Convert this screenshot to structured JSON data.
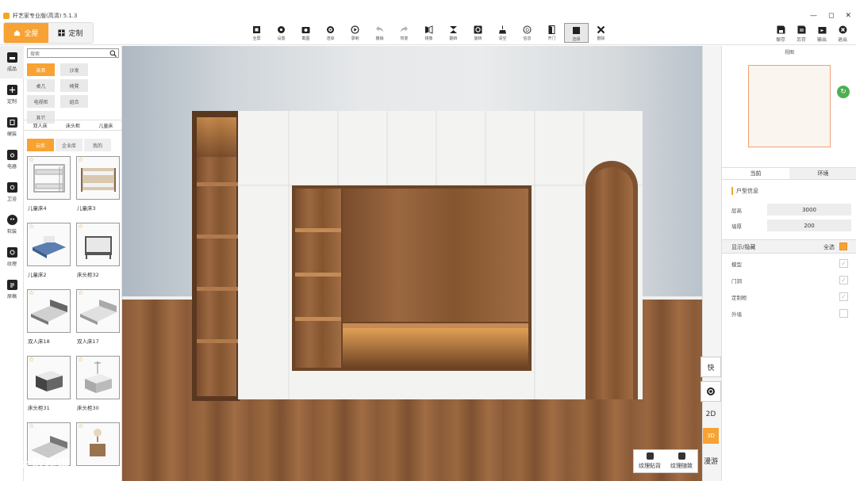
{
  "window": {
    "title": "杆艺家专业版(高清) 5.1.3",
    "controls": [
      "—",
      "◻",
      "✕"
    ]
  },
  "modes": [
    {
      "label": "全屋",
      "active": true
    },
    {
      "label": "定制",
      "active": false
    }
  ],
  "tools": [
    {
      "label": "全屏",
      "icon": "fullscreen-icon"
    },
    {
      "label": "设置",
      "icon": "settings-icon"
    },
    {
      "label": "截图",
      "icon": "camera-icon"
    },
    {
      "label": "渲染",
      "icon": "render-icon"
    },
    {
      "label": "录制",
      "icon": "record-icon"
    },
    {
      "label": "撤销",
      "icon": "undo-icon"
    },
    {
      "label": "恢复",
      "icon": "redo-icon"
    },
    {
      "label": "镜像",
      "icon": "mirror-icon"
    },
    {
      "label": "翻转",
      "icon": "flip-icon"
    },
    {
      "label": "旋转",
      "icon": "rotate-icon"
    },
    {
      "label": "清空",
      "icon": "clear-icon"
    },
    {
      "label": "信息",
      "icon": "info-icon"
    },
    {
      "label": "开门",
      "icon": "door-icon"
    },
    {
      "label": "选择",
      "icon": "select-icon"
    },
    {
      "label": "删除",
      "icon": "delete-icon"
    }
  ],
  "right_tools": [
    {
      "label": "保存",
      "icon": "save-icon"
    },
    {
      "label": "另存",
      "icon": "save-as-icon"
    },
    {
      "label": "输出",
      "icon": "export-icon"
    },
    {
      "label": "退出",
      "icon": "exit-icon"
    }
  ],
  "sidebar": [
    {
      "label": "成品",
      "icon": "sofa-icon",
      "active": true
    },
    {
      "label": "定制",
      "icon": "custom-icon"
    },
    {
      "label": "硬装",
      "icon": "hardware-icon"
    },
    {
      "label": "电器",
      "icon": "appliance-icon"
    },
    {
      "label": "卫浴",
      "icon": "bath-icon"
    },
    {
      "label": "软装",
      "icon": "decor-icon"
    },
    {
      "label": "纹理",
      "icon": "texture-icon"
    },
    {
      "label": "原稿",
      "icon": "draft-icon"
    }
  ],
  "library": {
    "search_placeholder": "搜索",
    "categories": [
      {
        "label": "床具",
        "active": true
      },
      {
        "label": "沙发"
      },
      {
        "label": "桌几"
      },
      {
        "label": "椅凳"
      },
      {
        "label": "电视柜"
      },
      {
        "label": "组合"
      },
      {
        "label": "其它"
      }
    ],
    "subcategories": [
      "双人床",
      "床头柜",
      "儿童床"
    ],
    "sources": [
      {
        "label": "云库",
        "active": true
      },
      {
        "label": "企业库"
      },
      {
        "label": "我的"
      }
    ],
    "items": [
      {
        "name": "儿童床4"
      },
      {
        "name": "儿童床3"
      },
      {
        "name": "儿童床2"
      },
      {
        "name": "床头柜32"
      },
      {
        "name": "双人床18"
      },
      {
        "name": "双人床17"
      },
      {
        "name": "床头柜31"
      },
      {
        "name": "床头柜30"
      },
      {
        "name": ""
      },
      {
        "name": ""
      }
    ]
  },
  "viewport": {
    "buttons": [
      {
        "label": "快",
        "icon": "quick-icon"
      },
      {
        "label": "",
        "icon": "reset-view-icon"
      },
      {
        "label": "2D"
      },
      {
        "label": "3D",
        "active": true
      },
      {
        "label": "漫游"
      }
    ],
    "texture_buttons": [
      "纹理贴背",
      "纹理随致"
    ]
  },
  "right_panel": {
    "view_label": "视图",
    "tabs": [
      {
        "label": "当前",
        "active": true
      },
      {
        "label": "环境"
      }
    ],
    "section_title": "户型信息",
    "props": [
      {
        "label": "层高",
        "value": "3000"
      },
      {
        "label": "墙厚",
        "value": "200"
      }
    ],
    "display_title": "显示/隐藏",
    "select_all": "全选",
    "toggles": [
      {
        "label": "模型",
        "checked": true
      },
      {
        "label": "门洞",
        "checked": true
      },
      {
        "label": "定制柜",
        "checked": true
      },
      {
        "label": "外墙",
        "checked": false
      }
    ]
  },
  "watermark": "大数跨境",
  "colors": {
    "accent": "#f7a233",
    "wood": "#8b5a36",
    "cabinet_white": "#f4f4f2"
  }
}
